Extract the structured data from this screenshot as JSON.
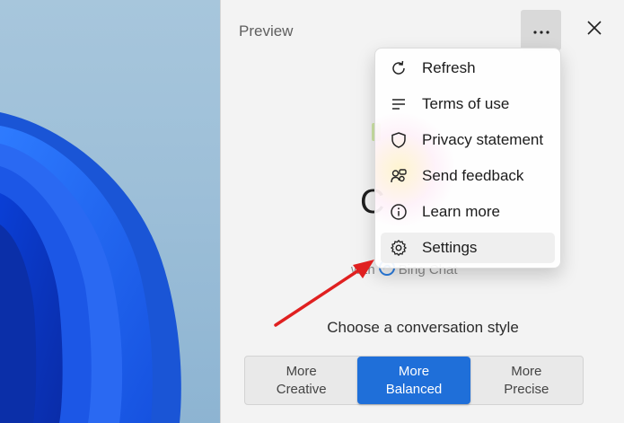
{
  "panel": {
    "title": "Preview",
    "heading_fragment": "C",
    "with_prefix": "with",
    "brand": "Bing Chat",
    "style_label": "Choose a conversation style"
  },
  "icons": {
    "more": "more-horizontal-icon",
    "close": "close-icon",
    "bing": "bing-logo-icon"
  },
  "menu": {
    "items": [
      {
        "label": "Refresh",
        "icon": "refresh-icon"
      },
      {
        "label": "Terms of use",
        "icon": "list-lines-icon"
      },
      {
        "label": "Privacy statement",
        "icon": "shield-icon"
      },
      {
        "label": "Send feedback",
        "icon": "feedback-icon"
      },
      {
        "label": "Learn more",
        "icon": "info-icon"
      },
      {
        "label": "Settings",
        "icon": "gear-icon"
      }
    ]
  },
  "styles": [
    {
      "line1": "More",
      "line2": "Creative",
      "selected": false
    },
    {
      "line1": "More",
      "line2": "Balanced",
      "selected": true
    },
    {
      "line1": "More",
      "line2": "Precise",
      "selected": false
    }
  ],
  "colors": {
    "accent": "#1f6fd9",
    "annotation_arrow": "#e02020"
  }
}
